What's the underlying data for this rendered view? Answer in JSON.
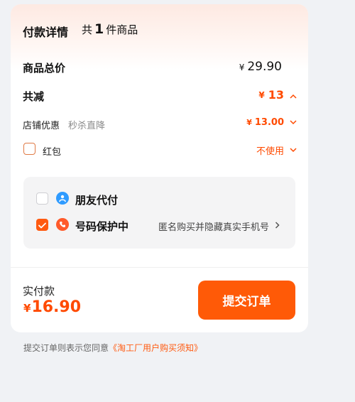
{
  "order": {
    "title": "付款详情",
    "count_prefix": "共",
    "count": "1",
    "count_suffix": "件商品",
    "total_label": "商品总价",
    "total_currency": "¥",
    "total_value": "29.90",
    "discount_label": "共减",
    "discount_currency": "¥",
    "discount_value": "13",
    "shop_label": "店铺优惠",
    "shop_tag": "秒杀直降",
    "shop_currency": "¥",
    "shop_value": "13.00",
    "red_packet_label": "红包",
    "red_packet_value": "不使用"
  },
  "services": {
    "friend_pay_label": "朋友代付",
    "friend_pay_checked": false,
    "protect_label": "号码保护中",
    "protect_checked": true,
    "protect_desc": "匿名购买并隐藏真实手机号"
  },
  "footer": {
    "pay_label": "实付款",
    "pay_currency": "¥",
    "pay_value": "16.90",
    "submit_label": "提交订单"
  },
  "agreement": {
    "text": "提交订单则表示您同意",
    "link": "《淘工厂用户购买须知》"
  },
  "colors": {
    "accent": "#ff5a07",
    "price": "#ff4a00",
    "background": "#f0f2f5",
    "friend_icon": "#2f9bff"
  },
  "icons": [
    "chevron-up-icon",
    "chevron-down-icon",
    "friend-pay-icon",
    "phone-protect-icon",
    "check-icon",
    "chevron-right-icon"
  ]
}
